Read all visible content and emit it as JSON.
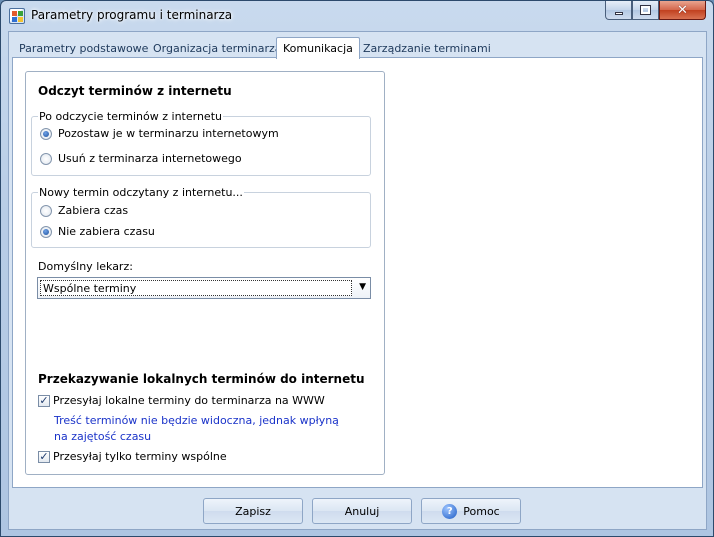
{
  "window": {
    "title": "Parametry programu i terminarza",
    "icon": "calendar-app-icon",
    "caption_buttons": [
      "minimize-icon",
      "maximize-icon",
      "close-icon"
    ]
  },
  "tabs": [
    {
      "label": "Parametry podstawowe",
      "active": false
    },
    {
      "label": "Organizacja terminarza",
      "active": false
    },
    {
      "label": "Komunikacja",
      "active": true
    },
    {
      "label": "Zarządzanie terminami",
      "active": false
    }
  ],
  "section_download": {
    "heading": "Odczyt terminów z internetu",
    "group_after_read": {
      "legend": "Po odczycie terminów z internetu",
      "options": [
        {
          "label": "Pozostaw je w terminarzu internetowym",
          "selected": true
        },
        {
          "label": "Usuń z terminarza internetowego",
          "selected": false
        }
      ]
    },
    "group_new_term": {
      "legend": "Nowy termin odczytany z internetu...",
      "options": [
        {
          "label": "Zabiera czas",
          "selected": false
        },
        {
          "label": "Nie zabiera czasu",
          "selected": true
        }
      ]
    },
    "default_doctor_label": "Domyślny lekarz:",
    "default_doctor_value": "Wspólne terminy"
  },
  "section_upload": {
    "heading": "Przekazywanie lokalnych terminów do internetu",
    "send_local": {
      "label": "Przesyłaj lokalne terminy do terminarza na WWW",
      "checked": true
    },
    "note_line1": "Treść terminów nie będzie widoczna, jednak wpłyną",
    "note_line2": "na zajętość czasu",
    "send_shared_only": {
      "label": "Przesyłaj tylko terminy wspólne",
      "checked": true
    }
  },
  "buttons": {
    "save": "Zapisz",
    "cancel": "Anuluj",
    "help": "Pomoc",
    "help_icon": "help-question-icon"
  },
  "colors": {
    "accent_blue": "#1a33c9",
    "close_button": "#c1401f"
  }
}
